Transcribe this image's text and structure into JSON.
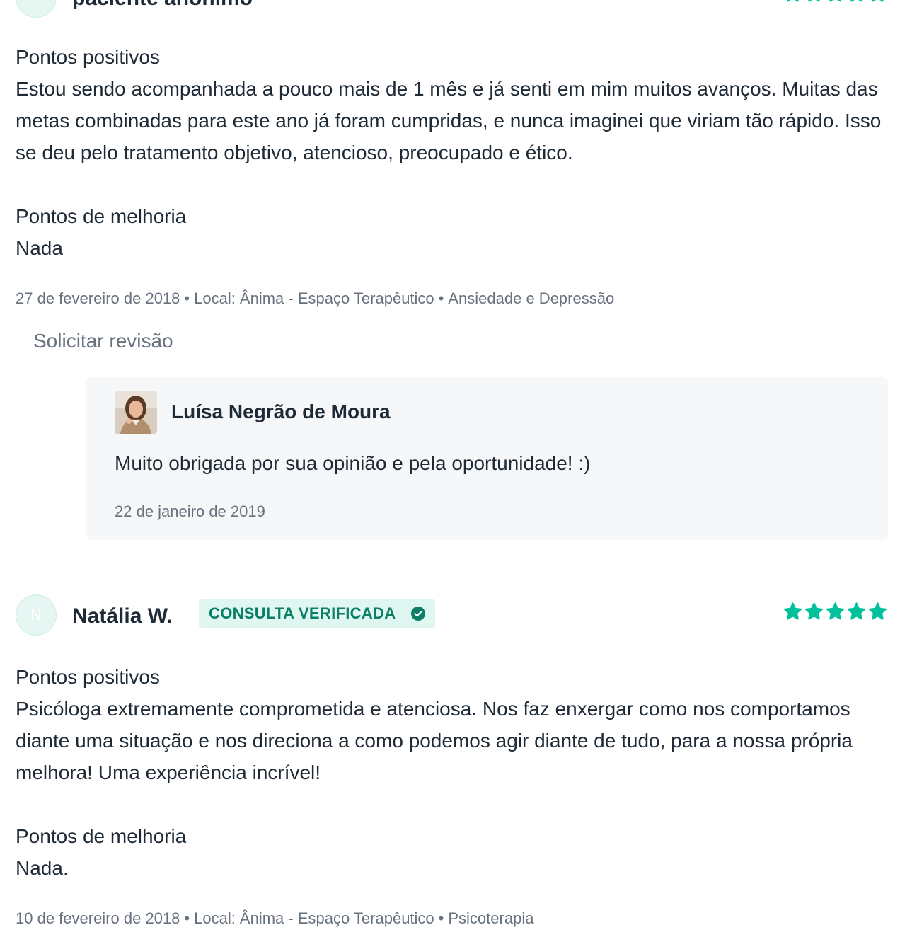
{
  "colors": {
    "accent": "#00c19a",
    "verified_bg": "#e0f6f0",
    "verified_text": "#0b7f66",
    "muted_text": "#68727f",
    "body_text": "#1f2a37",
    "reply_bg": "#f6f7f9"
  },
  "reviews": [
    {
      "avatar_initial": "P",
      "name": "paciente anônimo",
      "rating": 5,
      "positive_title": "Pontos positivos",
      "positive_text": "Estou sendo acompanhada a pouco mais de 1 mês e já senti em mim muitos avanços. Muitas das metas combinadas para este ano já foram cumpridas, e nunca imaginei que viriam tão rápido. Isso se deu pelo tratamento objetivo, atencioso, preocupado e ético.",
      "improve_title": "Pontos de melhoria",
      "improve_text": "Nada",
      "date": "27 de fevereiro de 2018",
      "location": "Local: Ânima - Espaço Terapêutico",
      "topic": "Ansiedade e Depressão",
      "separator": "•",
      "request_review_label": "Solicitar revisão",
      "reply": {
        "author": "Luísa Negrão de Moura",
        "avatar_icon": "professional-photo",
        "text": "Muito obrigada por sua opinião e pela oportunidade! :)",
        "date": "22 de janeiro de 2019"
      }
    },
    {
      "avatar_initial": "N",
      "name": "Natália W.",
      "verified_label": "CONSULTA VERIFICADA",
      "verified_icon": "check-circle-icon",
      "rating": 5,
      "positive_title": "Pontos positivos",
      "positive_text": "Psicóloga extremamente comprometida e atenciosa. Nos faz enxergar como nos comportamos diante uma situação e nos direciona a como podemos agir diante de tudo, para a nossa própria melhora! Uma experiência incrível!",
      "improve_title": "Pontos de melhoria",
      "improve_text": "Nada.",
      "date": "10 de fevereiro de 2018",
      "location": "Local: Ânima - Espaço Terapêutico",
      "topic": "Psicoterapia",
      "separator": "•"
    }
  ]
}
